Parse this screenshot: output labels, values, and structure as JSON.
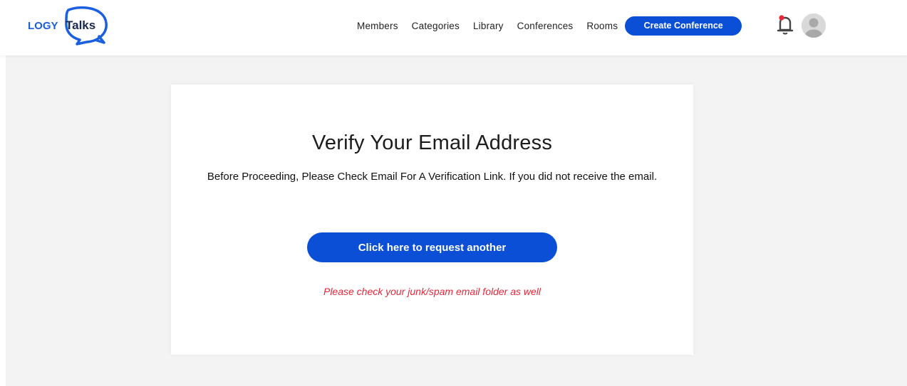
{
  "brand": {
    "logo_text_left": "LOGY",
    "logo_text_right": "Talks",
    "logo_colors": {
      "primary": "#1a5fe0",
      "text_dark": "#1a2a4a"
    }
  },
  "nav": {
    "items": [
      {
        "label": "Members"
      },
      {
        "label": "Categories"
      },
      {
        "label": "Library"
      },
      {
        "label": "Conferences"
      },
      {
        "label": "Rooms"
      }
    ],
    "create_label": "Create Conference"
  },
  "header_icons": {
    "notifications": "bell-icon",
    "avatar": "user-avatar"
  },
  "verify": {
    "title": "Verify Your Email Address",
    "description": "Before Proceeding, Please Check Email For A Verification Link. If you did not receive the email.",
    "button_label": "Click here to request another",
    "spam_note": "Please check your junk/spam email folder as well"
  },
  "colors": {
    "accent": "#0a4fd6",
    "warning_text": "#e8263a",
    "page_background": "#f3f3f3",
    "notification_dot": "#e8263a"
  }
}
